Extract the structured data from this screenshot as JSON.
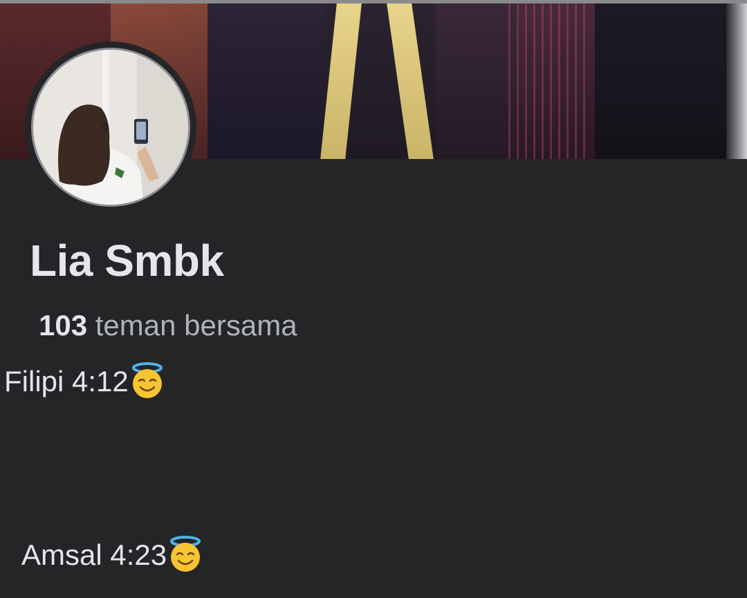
{
  "profile": {
    "name": "Lia Smbk",
    "mutual_friends": {
      "count": "103",
      "label": "teman bersama"
    },
    "bio": {
      "line1": "Filipi 4:12",
      "line2": "Amsal 4:23",
      "emoji_icon": "smiling-face-with-halo-icon"
    }
  },
  "colors": {
    "background": "#242527",
    "primary_text": "#e4e6eb",
    "secondary_text": "#b0b3b8"
  }
}
